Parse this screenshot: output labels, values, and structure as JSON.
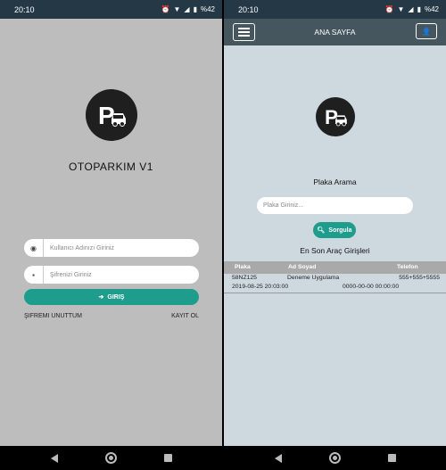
{
  "login": {
    "status_time": "20:10",
    "battery": "%42",
    "title": "OTOPARKIM V1",
    "username_placeholder": "Kullanıcı Adınızı Giriniz",
    "password_placeholder": "Şifrenizi Giriniz",
    "login_button": "GIRIŞ",
    "forgot_password": "ŞIFREMI UNUTTUM",
    "register": "KAYIT OL"
  },
  "home": {
    "status_time": "20:10",
    "battery": "%42",
    "appbar_title": "ANA SAYFA",
    "plate_search_title": "Plaka Arama",
    "plate_placeholder": "Plaka Giriniz...",
    "search_button": "Sorgula",
    "recent_title": "En Son Araç Girişleri",
    "table": {
      "headers": [
        "Plaka",
        "Ad Soyad",
        "Telefon"
      ],
      "rows": [
        {
          "plate": "58NZ125",
          "name": "Deneme Uygulama",
          "phone": "555+555+5555",
          "entry": "2019-08-25 20:03:00",
          "exit": "0000-00-00 00:00:00"
        }
      ]
    }
  },
  "colors": {
    "statusbar": "#243845",
    "appbar": "#45565f",
    "accent": "#1e9c8c",
    "login_bg": "#bdbdbd",
    "home_bg": "#ced8df"
  },
  "icons": [
    "alarm-icon",
    "wifi-icon",
    "signal-icon",
    "battery-icon",
    "parking-logo-icon",
    "user-icon",
    "lock-icon",
    "sign-in-icon",
    "menu-icon",
    "search-icon",
    "back-icon",
    "home-icon",
    "recents-icon"
  ]
}
